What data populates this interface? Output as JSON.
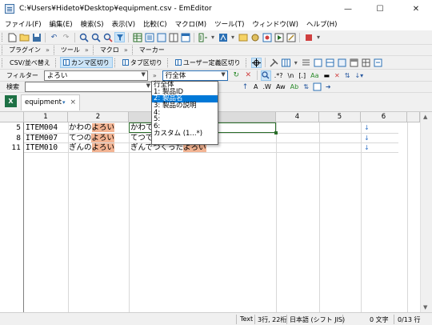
{
  "window": {
    "title": "C:¥Users¥Hideto¥Desktop¥equipment.csv - EmEditor",
    "controls": {
      "minimize": "—",
      "maximize": "☐",
      "close": "✕"
    }
  },
  "menu": [
    "ファイル(F)",
    "編集(E)",
    "検索(S)",
    "表示(V)",
    "比較(C)",
    "マクロ(M)",
    "ツール(T)",
    "ウィンドウ(W)",
    "ヘルプ(H)"
  ],
  "toolbar2": {
    "plugin": "プラグイン",
    "tools": "ツール",
    "macro": "マクロ",
    "marker": "マーカー"
  },
  "csvbar": {
    "csv_convert": "CSV/並べ替え",
    "comma": "カンマ区切り",
    "tab": "タブ区切り",
    "user": "ユーザー定義区切り"
  },
  "filterbar": {
    "label": "フィルター",
    "value": "よろい",
    "column_value": "行全体"
  },
  "searchbar": {
    "label": "検索"
  },
  "tab": {
    "name": "equipment"
  },
  "columns": [
    "1",
    "2",
    "3",
    "4",
    "5",
    "6"
  ],
  "rows": [
    {
      "num": "5",
      "c1": "ITEM004",
      "c2a": "かわの",
      "c2b": "よろい",
      "c3a": "かわで",
      "c3b": "",
      "c3c": ""
    },
    {
      "num": "8",
      "c1": "ITEM007",
      "c2a": "てつの",
      "c2b": "よろい",
      "c3a": "てつで",
      "c3b": "",
      "c3c": ""
    },
    {
      "num": "11",
      "c1": "ITEM010",
      "c2a": "ぎんの",
      "c2b": "よろい",
      "c3a": "ぎんでつくった",
      "c3b": "よろい",
      "c3c": ""
    }
  ],
  "dropdown": {
    "items": [
      "行全体",
      "1: 製品ID",
      "2: 製品名",
      "3: 製品の説明",
      "4:",
      "5:",
      "6:",
      "カスタム (1...*)"
    ],
    "selected_index": 2
  },
  "status": {
    "encoding_label": "Text",
    "position": "3行, 22桁",
    "encoding": "日本語 (シフト JIS)",
    "chars": "0 文字",
    "lines": "0/13 行"
  },
  "colors": {
    "highlight": "#f3b493",
    "selection": "#0078d7",
    "accent": "#2a6fb4"
  }
}
